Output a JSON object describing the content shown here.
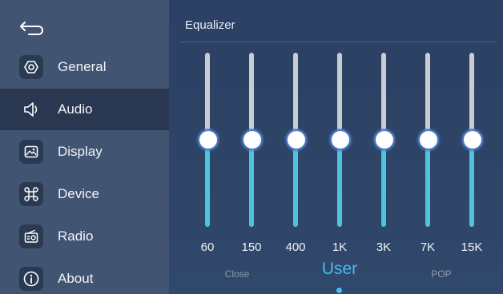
{
  "header": {
    "title": "Equalizer"
  },
  "sidebar": {
    "items": [
      {
        "label": "General",
        "icon": "gear-hexagon-icon"
      },
      {
        "label": "Audio",
        "icon": "speaker-icon",
        "active": true
      },
      {
        "label": "Display",
        "icon": "picture-icon"
      },
      {
        "label": "Device",
        "icon": "command-icon"
      },
      {
        "label": "Radio",
        "icon": "radio-icon"
      },
      {
        "label": "About",
        "icon": "info-icon"
      }
    ]
  },
  "equalizer": {
    "bands": [
      {
        "freq": "60",
        "level": 0.5
      },
      {
        "freq": "150",
        "level": 0.5
      },
      {
        "freq": "400",
        "level": 0.5
      },
      {
        "freq": "1K",
        "level": 0.5
      },
      {
        "freq": "3K",
        "level": 0.5
      },
      {
        "freq": "7K",
        "level": 0.5
      },
      {
        "freq": "15K",
        "level": 0.5
      }
    ],
    "presets": {
      "previous": "Close",
      "current": "User",
      "next": "POP"
    }
  },
  "colors": {
    "accent": "#3fc0f0",
    "track_active": "#4fc3de",
    "track_inactive": "#c9ccd1",
    "sidebar_bg": "#415573",
    "sidebar_active_bg": "#293850"
  }
}
